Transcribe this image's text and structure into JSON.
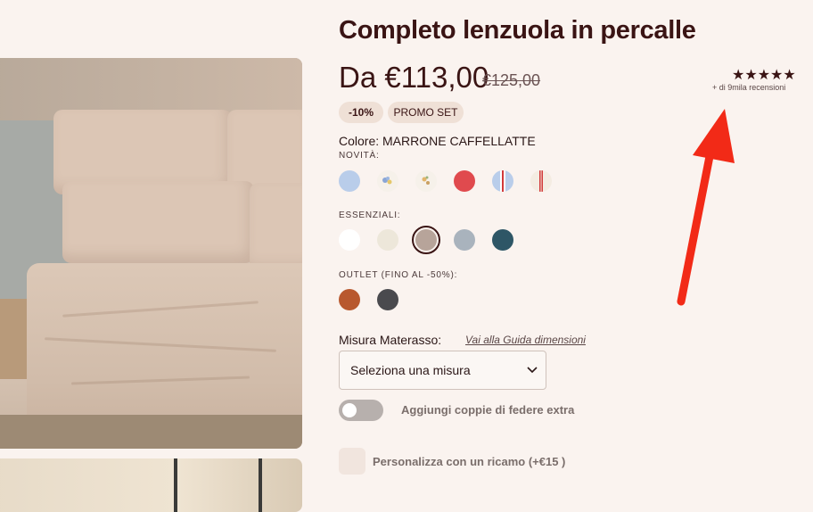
{
  "product": {
    "title": "Completo lenzuola in percalle",
    "price": "Da €113,00",
    "old_price": "€125,00",
    "rating_stars": "★★★★★",
    "reviews_text": "+ di 9mila recensioni",
    "badges": {
      "discount": "-10%",
      "promo": "PROMO SET"
    }
  },
  "color": {
    "label": "Colore: MARRONE CAFFELLATTE",
    "groups": {
      "novita": "NOVITÀ:",
      "essenziali": "ESSENZIALI:",
      "outlet": "OUTLET (FINO AL -50%):"
    },
    "swatch_colors": {
      "light_blue": "#b9cdea",
      "floral_bg": "#f6f1ea",
      "red": "#e04a4e",
      "white": "#ffffff",
      "cream": "#ede7da",
      "caffellatte": "#b7a49a",
      "gray_blue": "#a9b3bd",
      "petrol": "#2e5666",
      "rust": "#b8582e",
      "charcoal": "#4a4a4e"
    }
  },
  "size": {
    "label": "Misura Materasso:",
    "guide_link": "Vai alla Guida dimensioni",
    "select_value": "Seleziona una misura"
  },
  "options": {
    "extra_pillowcases": "Aggiungi coppie di federe extra",
    "embroidery": "Personalizza con un ricamo (+€15 )"
  },
  "annotation_arrow_color": "#f22a17"
}
